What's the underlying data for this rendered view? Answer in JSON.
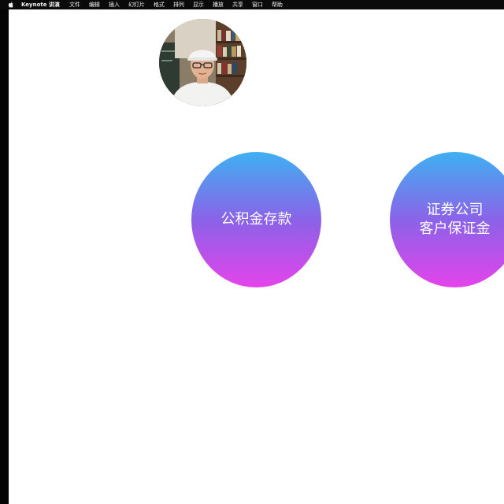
{
  "menubar": {
    "app_name": "Keynote 讲演",
    "items": [
      "文件",
      "编辑",
      "插入",
      "幻灯片",
      "格式",
      "排列",
      "显示",
      "播放",
      "共享",
      "窗口",
      "帮助"
    ]
  },
  "icons": {
    "apple": "apple-logo-icon"
  },
  "slide": {
    "bubbles": [
      {
        "lines": [
          "公积金存款"
        ]
      },
      {
        "lines": [
          "证券公司",
          "客户保证金"
        ]
      }
    ]
  },
  "colors": {
    "gradient_top": "#3fb0f2",
    "gradient_mid": "#8a63e8",
    "gradient_bottom": "#e443ea",
    "menubar_bg": "#0a0a0a"
  }
}
